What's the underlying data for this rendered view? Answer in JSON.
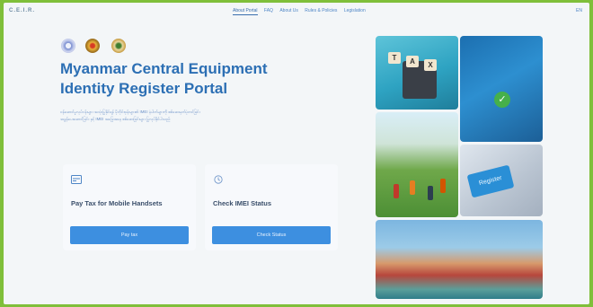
{
  "header": {
    "logo_text": "C.E.I.R.",
    "nav": [
      "About Portal",
      "FAQ",
      "About Us",
      "Rules & Policies",
      "Legislation"
    ],
    "lang_label": "EN"
  },
  "hero": {
    "title_line1": "Myanmar Central Equipment",
    "title_line2": "Identity Register Portal",
    "description_line1": "ဝန်ဆောင်မှုလုပ်ငန်းများ အသုံးပြုနိုင်ရန် မိုဘိုင်းဖုန်းများ၏ IMEI နံပါတ်များကို စစ်ဆေးမှတ်ပုံတင်ခြင်း",
    "description_line2": "အခွန်ပေးဆောင်ခြင်း နှင့် IMEI အခြေအနေ စစ်ဆေးခြင်းများ ပြုလုပ်နိုင်ပါသည်"
  },
  "cards": [
    {
      "title": "Pay Tax for Mobile Handsets",
      "button": "Pay tax",
      "icon": "phone-card-icon"
    },
    {
      "title": "Check IMEI Status",
      "button": "Check Status",
      "icon": "clock-check-icon"
    }
  ],
  "images": {
    "tax_keys": [
      "T",
      "A",
      "X"
    ],
    "register_label": "Register"
  },
  "colors": {
    "accent": "#2c6fb4",
    "button": "#3d8fe0",
    "frame": "#7fbf3a"
  }
}
